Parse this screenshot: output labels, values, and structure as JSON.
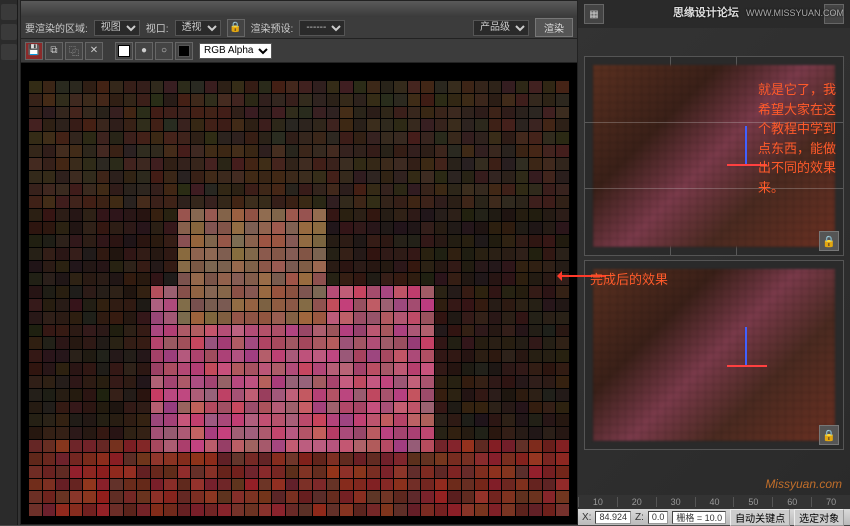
{
  "watermark": {
    "text": "思缘设计论坛",
    "url": "WWW.MISSYUAN.COM"
  },
  "render_window": {
    "region_label": "要渲染的区域:",
    "region_value": "视图",
    "viewport_label": "视口:",
    "viewport_value": "透视",
    "preset_label": "渲染预设:",
    "preset_value": "------",
    "output_label": "产品级",
    "render_btn": "渲染",
    "channel_value": "RGB Alpha"
  },
  "annotations": {
    "main": "就是它了，我希望大家在这个教程中学到点东西，能做出不同的效果来。",
    "result": "完成后的效果"
  },
  "timeline": {
    "ticks": [
      "10",
      "20",
      "30",
      "40",
      "50",
      "60",
      "70"
    ]
  },
  "status_bar": {
    "coord_x": "84.924",
    "coord_z": "0.0",
    "grid_label": "栅格 = 10.0",
    "auto_key": "自动关键点",
    "sel_obj": "选定对象"
  },
  "orange_watermark": "Missyuan.com",
  "icons": {
    "save": "💾",
    "copy": "⧉",
    "clone": "⿻",
    "close": "✕",
    "color": "◧",
    "rgb": "●",
    "alpha": "○",
    "lock": "🔒"
  }
}
